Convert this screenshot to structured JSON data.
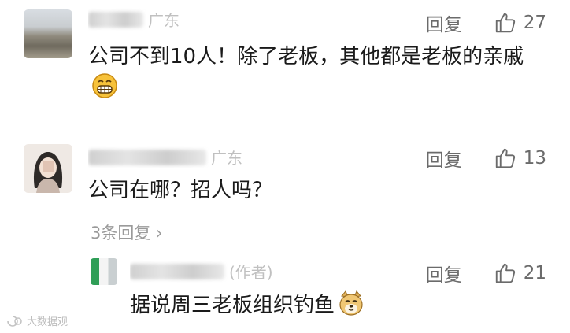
{
  "comments": [
    {
      "region": "广东",
      "reply_label": "回复",
      "likes": "27",
      "text": "公司不到10人！除了老板，其他都是老板的亲戚",
      "emoji": "grin-face-icon"
    },
    {
      "region": "广东",
      "reply_label": "回复",
      "likes": "13",
      "text": "公司在哪？招人吗？",
      "more_replies": "3条回复"
    },
    {
      "author_tag": "(作者)",
      "reply_label": "回复",
      "likes": "21",
      "text": "据说周三老板组织钓鱼",
      "emoji": "doge-face-icon"
    }
  ],
  "watermark": "大数据观",
  "colors": {
    "text": "#1a1a1a",
    "meta": "#6b6b6b",
    "link": "#9a9a9a"
  }
}
